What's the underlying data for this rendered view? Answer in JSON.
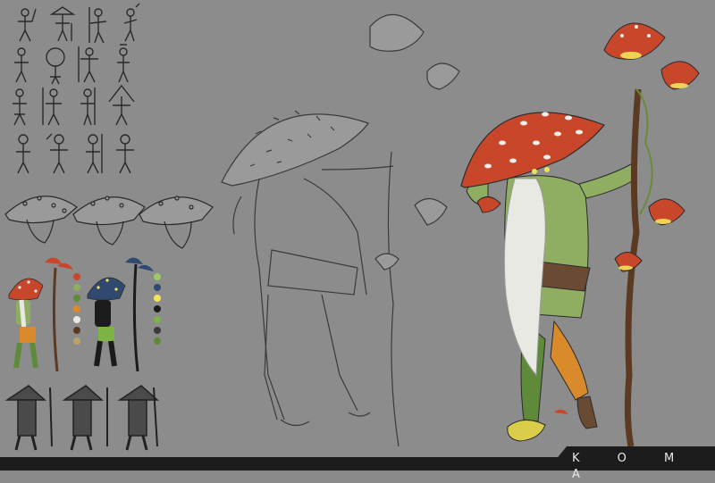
{
  "brand": {
    "label": "K O M A"
  },
  "palette": {
    "background": "#8c8c8c",
    "cap_red": "#c8462a",
    "cap_blue": "#2f4a6e",
    "shirt_green": "#8fae62",
    "pants_green": "#5f8a3a",
    "orange": "#d98a2a",
    "beard_white": "#e9e9e4",
    "staff_brown": "#5a3a22",
    "glow_yellow": "#f2e25a",
    "footer_dark": "#1c1c1c"
  },
  "swatches": {
    "set_one": [
      "#c8462a",
      "#8fae62",
      "#5f8a3a",
      "#d98a2a",
      "#e9e9e4",
      "#5a3a22",
      "#b9a46a",
      "#f2e25a"
    ],
    "set_two": [
      "#2f4a6e",
      "#f2e25a",
      "#1b1b1b",
      "#7cb342",
      "#5f8a3a",
      "#3a3a3a",
      "#9ccc65",
      "#2b2b2b"
    ]
  }
}
